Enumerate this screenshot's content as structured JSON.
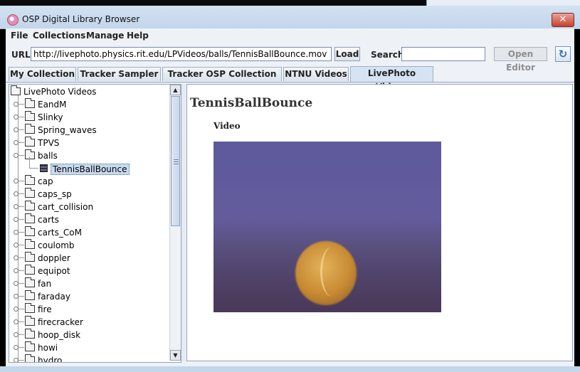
{
  "window": {
    "title": "OSP Digital Library Browser",
    "close_glyph": "✕"
  },
  "menubar": {
    "items": [
      "File",
      "Collections",
      "Manage",
      "Help"
    ]
  },
  "toolbar": {
    "url_label": "URL:",
    "url_value": "http://livephoto.physics.rit.edu/LPVideos/balls/TennisBallBounce.mov",
    "load_label": "Load",
    "search_label": "Search",
    "search_value": "",
    "open_editor_label": "Open Editor",
    "refresh_icon": "refresh-icon"
  },
  "tabs": [
    {
      "label": "My Collection"
    },
    {
      "label": "Tracker Sampler"
    },
    {
      "label": "Tracker OSP Collection",
      "minus": "–"
    },
    {
      "label": "NTNU Videos"
    },
    {
      "label": "LivePhoto Videos",
      "active": true
    }
  ],
  "tree": {
    "root": "LivePhoto Videos",
    "items": [
      "EandM",
      "Slinky",
      "Spring_waves",
      "TPVS",
      "balls",
      "cap",
      "caps_sp",
      "cart_collision",
      "carts",
      "carts_CoM",
      "coulomb",
      "doppler",
      "equipot",
      "fan",
      "faraday",
      "fire",
      "firecracker",
      "hoop_disk",
      "howi",
      "hydro"
    ],
    "expanded_child": "TennisBallBounce",
    "scroll_up": "▲",
    "scroll_down": "▼"
  },
  "document": {
    "title": "TennisBallBounce",
    "subtitle": "Video"
  }
}
